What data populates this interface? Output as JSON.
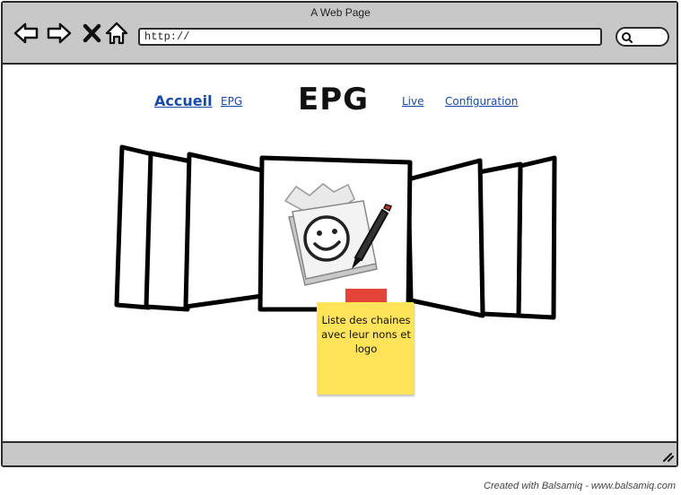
{
  "window": {
    "title": "A Web Page",
    "url": "http://"
  },
  "toolbar": {
    "icons": [
      "back-arrow-icon",
      "forward-arrow-icon",
      "stop-x-icon",
      "home-icon",
      "search-icon"
    ]
  },
  "nav": {
    "home": "Accueil",
    "epg": "EPG",
    "page_title": "EPG",
    "live": "Live",
    "configuration": "Configuration"
  },
  "sticky_note": {
    "text": "Liste des chaines avec leur nons et logo"
  },
  "footer": {
    "credit": "Created with Balsamiq - www.balsamiq.com"
  },
  "colors": {
    "chrome": "#c8c8c8",
    "link": "#1a4aa8",
    "sticky": "#ffe45a",
    "tape": "#e23a2c"
  }
}
